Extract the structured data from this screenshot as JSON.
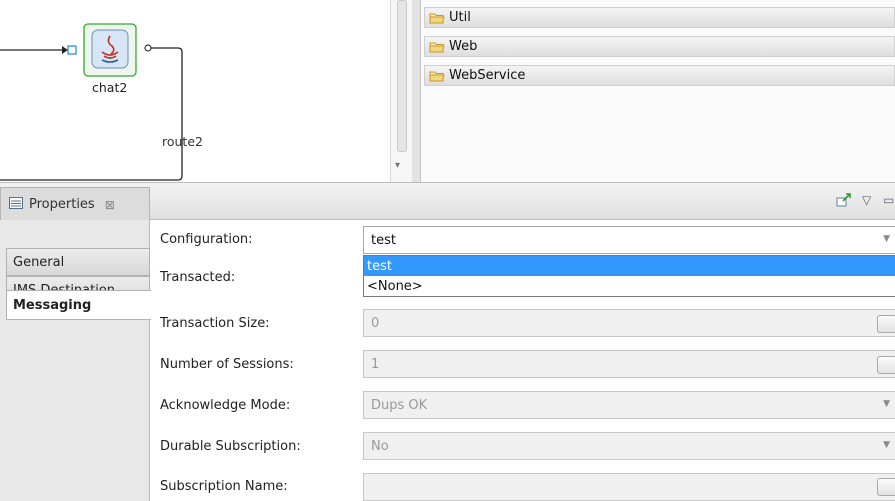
{
  "canvas": {
    "node_label": "chat2",
    "route_label": "route2"
  },
  "palette": {
    "items": [
      "Util",
      "Web",
      "WebService"
    ]
  },
  "properties": {
    "tab_label": "Properties",
    "tab_close": "⊠"
  },
  "side_tabs": [
    "General",
    "JMS Destination",
    "Messaging"
  ],
  "form": {
    "configuration_label": "Configuration:",
    "configuration_value": "test",
    "dropdown_options": [
      "test",
      "<None>"
    ],
    "transacted_label": "Transacted:",
    "transaction_size_label": "Transaction Size:",
    "transaction_size_value": "0",
    "sessions_label": "Number of Sessions:",
    "sessions_value": "1",
    "ack_label": "Acknowledge Mode:",
    "ack_value": "Dups OK",
    "durable_label": "Durable Subscription:",
    "durable_value": "No",
    "subscription_name_label": "Subscription Name:",
    "subscription_name_value": ""
  },
  "icons": {
    "node": "java-component-icon",
    "palette_item": "folder-icon",
    "properties": "properties-view-icon"
  },
  "colors": {
    "selection": "#3399ff",
    "node_border": "#33aa33"
  }
}
